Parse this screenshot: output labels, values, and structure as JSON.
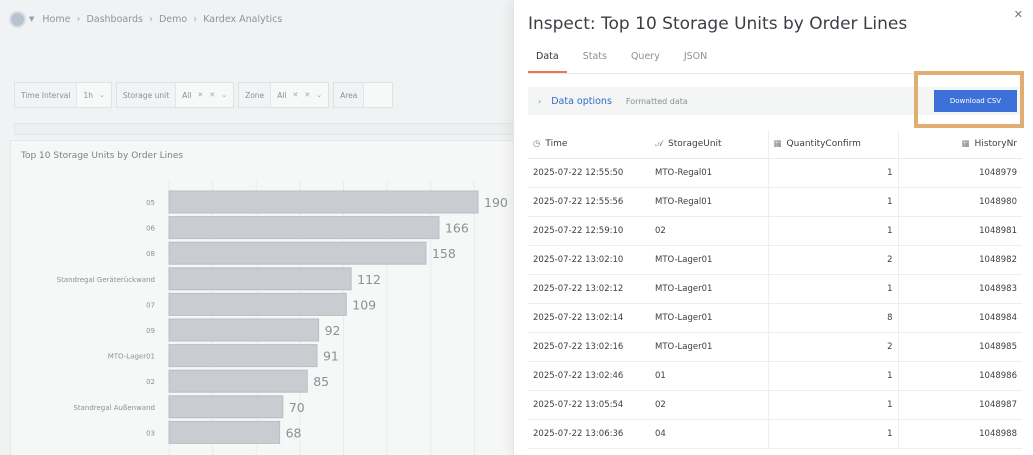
{
  "breadcrumb": [
    "Home",
    "Dashboards",
    "Demo",
    "Kardex Analytics"
  ],
  "filters": [
    {
      "label": "Time Interval",
      "value": "1h"
    },
    {
      "label": "Storage unit",
      "value": "All"
    },
    {
      "label": "Zone",
      "value": "All"
    },
    {
      "label": "Area",
      "value": ""
    }
  ],
  "panel": {
    "title": "Top 10 Storage Units by Order Lines"
  },
  "chart_data": {
    "type": "bar",
    "orientation": "horizontal",
    "title": "Top 10 Storage Units by Order Lines",
    "categories": [
      "05",
      "06",
      "08",
      "Standregal Geräterückwand",
      "07",
      "09",
      "MTO-Lager01",
      "02",
      "Standregal Außenwand",
      "03"
    ],
    "values": [
      190,
      166,
      158,
      112,
      109,
      92,
      91,
      85,
      70,
      68
    ],
    "xlim": [
      0,
      190
    ],
    "color": "#c9cdd1",
    "grid": true
  },
  "inspect": {
    "title": "Inspect: Top 10 Storage Units by Order Lines",
    "tabs": [
      "Data",
      "Stats",
      "Query",
      "JSON"
    ],
    "active_tab": "Data",
    "options_label": "Data options",
    "options_sub": "Formatted data",
    "download_label": "Download CSV",
    "columns": [
      {
        "label": "Time",
        "icon": "clock-icon"
      },
      {
        "label": "StorageUnit",
        "icon": "text-field-icon"
      },
      {
        "label": "QuantityConfirm",
        "icon": "table-field-icon"
      },
      {
        "label": "HistoryNr",
        "icon": "table-field-icon"
      }
    ],
    "rows": [
      [
        "2025-07-22 12:55:50",
        "MTO-Regal01",
        "1",
        "1048979"
      ],
      [
        "2025-07-22 12:55:56",
        "MTO-Regal01",
        "1",
        "1048980"
      ],
      [
        "2025-07-22 12:59:10",
        "02",
        "1",
        "1048981"
      ],
      [
        "2025-07-22 13:02:10",
        "MTO-Lager01",
        "2",
        "1048982"
      ],
      [
        "2025-07-22 13:02:12",
        "MTO-Lager01",
        "1",
        "1048983"
      ],
      [
        "2025-07-22 13:02:14",
        "MTO-Lager01",
        "8",
        "1048984"
      ],
      [
        "2025-07-22 13:02:16",
        "MTO-Lager01",
        "2",
        "1048985"
      ],
      [
        "2025-07-22 13:02:46",
        "01",
        "1",
        "1048986"
      ],
      [
        "2025-07-22 13:05:54",
        "02",
        "1",
        "1048987"
      ],
      [
        "2025-07-22 13:06:36",
        "04",
        "1",
        "1048988"
      ]
    ]
  }
}
